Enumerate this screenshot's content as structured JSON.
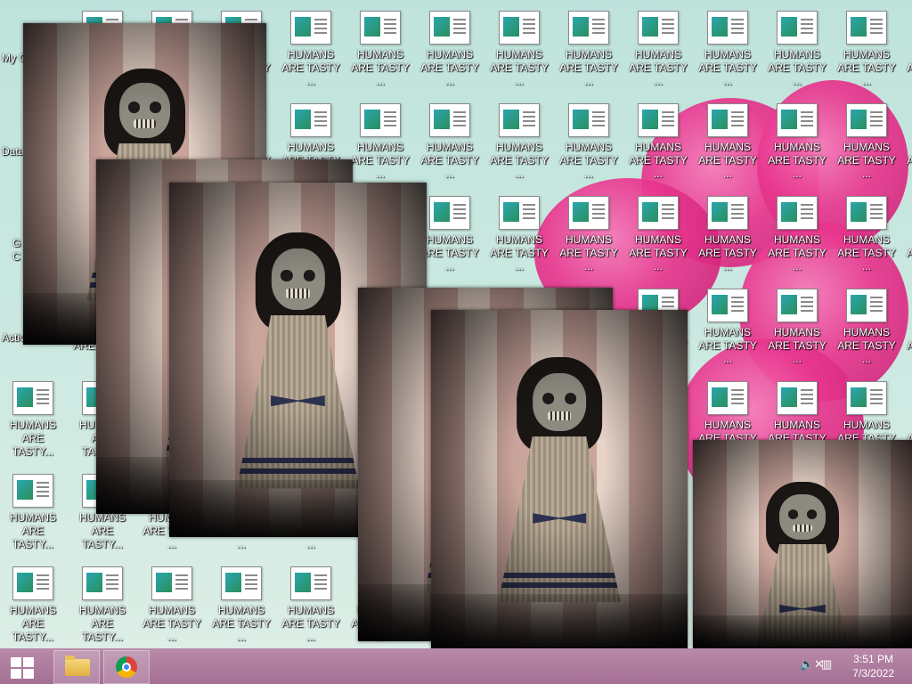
{
  "desktop": {
    "system_icons": [
      {
        "label": "My C"
      },
      {
        "label": "Data"
      },
      {
        "label": "G\nC"
      },
      {
        "label": "Activ"
      }
    ],
    "file_icon_label": "HUMANS\nARE TASTY ...",
    "file_icon_label_short": "HUMANS\nARE TASTY..."
  },
  "popups": {
    "image_desc": "creepy doll photo"
  },
  "taskbar": {
    "start_label": "Start",
    "pinned": [
      {
        "name": "File Explorer"
      },
      {
        "name": "Google Chrome"
      }
    ],
    "tray": {
      "volume_icon": "speaker-muted-icon",
      "network_icon": "network-icon"
    },
    "clock": {
      "time": "3:51 PM",
      "date": "7/3/2022"
    }
  },
  "colors": {
    "taskbar": "#a46f94",
    "desktop_bg": "#c9e8e0",
    "flower": "#e8368e"
  }
}
